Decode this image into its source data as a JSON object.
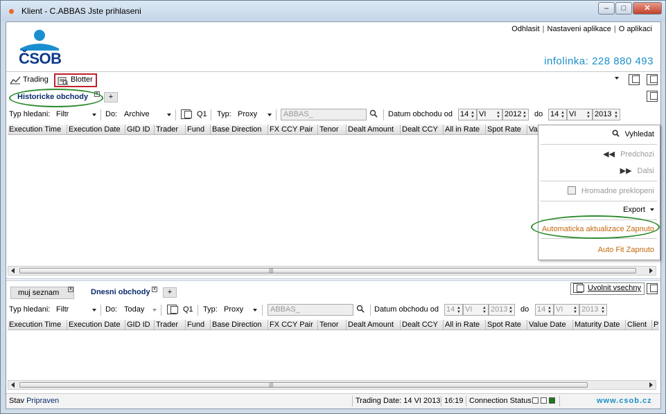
{
  "window": {
    "title": "Klient - C.ABBAS Jste prihlaseni",
    "minimize": "–",
    "maximize": "□",
    "close": "✕"
  },
  "brand": {
    "logo_text": "ČSOB",
    "infoline": "infolinka: 228 880 493",
    "url": "www.csob.cz"
  },
  "toplinks": {
    "logout": "Odhlasit",
    "settings": "Nastaveni aplikace",
    "about": "O aplikaci"
  },
  "toolbar": {
    "trading": "Trading",
    "blotter": "Blotter"
  },
  "top_panel": {
    "tabs": [
      {
        "label": "Historicke obchody",
        "active": true
      }
    ],
    "add_tab": "+",
    "filter": {
      "search_type_label": "Typ hledani:",
      "search_type_value": "Filtr",
      "source_label": "Do:",
      "source_value": "Archive",
      "q_label": "Q1",
      "type_label": "Typ:",
      "type_value": "Proxy",
      "search_value": "ABBAS_",
      "date_label": "Datum obchodu od",
      "from_day": "14",
      "from_month": "VI",
      "from_year": "2012",
      "to_label": "do",
      "to_day": "14",
      "to_month": "VI",
      "to_year": "2013"
    },
    "columns": [
      "Execution Time",
      "Execution Date",
      "GID ID",
      "Trader",
      "Fund",
      "Base Direction",
      "FX CCY Pair",
      "Tenor",
      "Dealt Amount",
      "Dealt CCY",
      "All in Rate",
      "Spot Rate",
      "Va"
    ]
  },
  "popup_menu": {
    "search": "Vyhledat",
    "previous": "Predchozi",
    "next": "Dalsi",
    "bulk_translate": "Hromadne preklopeni",
    "export": "Export",
    "auto_update": "Automaticka aktualizace Zapnuto",
    "auto_fit": "Auto Fit Zapnuto"
  },
  "bottom_panel": {
    "tabs": [
      {
        "label": "muj seznam",
        "active": false
      },
      {
        "label": "Dnesni obchody",
        "active": true
      }
    ],
    "add_tab": "+",
    "release_all": "Uvolnit vsechny",
    "filter": {
      "search_type_label": "Typ hledani:",
      "search_type_value": "Filtr",
      "source_label": "Do:",
      "source_value": "Today",
      "q_label": "Q1",
      "type_label": "Typ:",
      "type_value": "Proxy",
      "search_value": "ABBAS_",
      "date_label": "Datum obchodu od",
      "from_day": "14",
      "from_month": "VI",
      "from_year": "2013",
      "to_label": "do",
      "to_day": "14",
      "to_month": "VI",
      "to_year": "2013"
    },
    "columns": [
      "Execution Time",
      "Execution Date",
      "GID ID",
      "Trader",
      "Fund",
      "Base Direction",
      "FX CCY Pair",
      "Tenor",
      "Dealt Amount",
      "Dealt CCY",
      "All in Rate",
      "Spot Rate",
      "Value Date",
      "Maturity Date",
      "Client",
      "Pr"
    ]
  },
  "status": {
    "state_label": "Stav",
    "state_value": "Pripraven",
    "trading_date": "Trading Date: 14 VI 2013",
    "time": "16:19",
    "connection": "Connection Status"
  },
  "colors": {
    "accent": "#1a8fc8",
    "highlight_green": "#2e8b2e",
    "highlight_red": "#c0202a",
    "brand_blue": "#0a3a8a"
  }
}
